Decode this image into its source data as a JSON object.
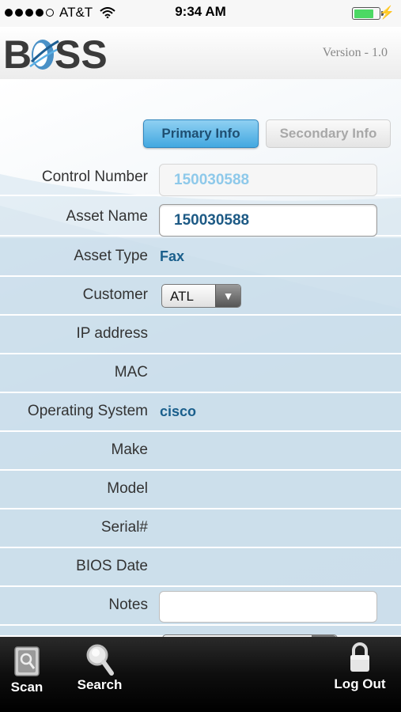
{
  "status_bar": {
    "carrier": "AT&T",
    "time": "9:34 AM",
    "battery_level": 0.8
  },
  "header": {
    "logo_text": "BOSS",
    "version": "Version - 1.0"
  },
  "tabs": [
    {
      "label": "Primary Info",
      "active": true
    },
    {
      "label": "Secondary Info",
      "active": false
    }
  ],
  "form": {
    "control_number": {
      "label": "Control Number",
      "value": "150030588"
    },
    "asset_name": {
      "label": "Asset Name",
      "value": "150030588"
    },
    "asset_type": {
      "label": "Asset Type",
      "value": "Fax"
    },
    "customer": {
      "label": "Customer",
      "value": "ATL"
    },
    "ip_address": {
      "label": "IP address",
      "value": ""
    },
    "mac": {
      "label": "MAC",
      "value": ""
    },
    "operating_system": {
      "label": "Operating System",
      "value": "cisco"
    },
    "make": {
      "label": "Make",
      "value": ""
    },
    "model": {
      "label": "Model",
      "value": ""
    },
    "serial": {
      "label": "Serial#",
      "value": ""
    },
    "bios_date": {
      "label": "BIOS Date",
      "value": ""
    },
    "notes": {
      "label": "Notes",
      "value": ""
    }
  },
  "bottom_bar": {
    "scan": {
      "label": "Scan",
      "icon": "scan-icon"
    },
    "search": {
      "label": "Search",
      "icon": "magnifier-icon"
    },
    "logout": {
      "label": "Log Out",
      "icon": "padlock-icon"
    }
  },
  "colors": {
    "accent": "#43a8e0",
    "value_text": "#1a5f8c",
    "row_shade": "#c4daea"
  }
}
